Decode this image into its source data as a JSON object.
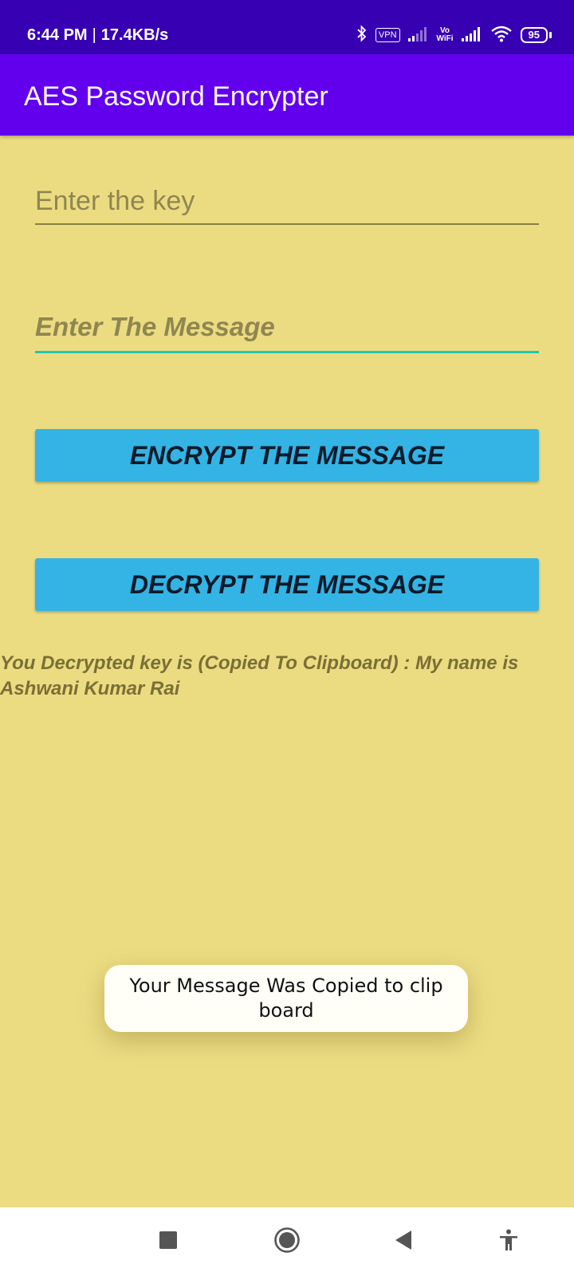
{
  "status_bar": {
    "time": "6:44 PM",
    "separator": "|",
    "speed": "17.4KB/s",
    "vpn_label": "VPN",
    "vowifi_line1": "Vo",
    "vowifi_line2": "WiFi",
    "battery": "95"
  },
  "app_bar": {
    "title": "AES Password Encrypter"
  },
  "form": {
    "key_placeholder": "Enter the key",
    "key_value": "",
    "message_placeholder": "Enter The Message",
    "message_value": ""
  },
  "buttons": {
    "encrypt_label": "ENCRYPT THE MESSAGE",
    "decrypt_label": "DECRYPT THE MESSAGE"
  },
  "result": {
    "text": "You Decrypted key is (Copied To Clipboard) : My name is Ashwani Kumar Rai"
  },
  "toast": {
    "text": "Your Message Was Copied to clip board"
  },
  "colors": {
    "status_bar": "#3700b3",
    "app_bar": "#6200ee",
    "background": "#ebdc82",
    "button": "#33b4e4",
    "focus_underline": "#1ec9b0"
  },
  "nav_bar": {
    "icons": [
      "recents-square-icon",
      "home-circle-icon",
      "back-triangle-icon",
      "accessibility-icon"
    ]
  }
}
